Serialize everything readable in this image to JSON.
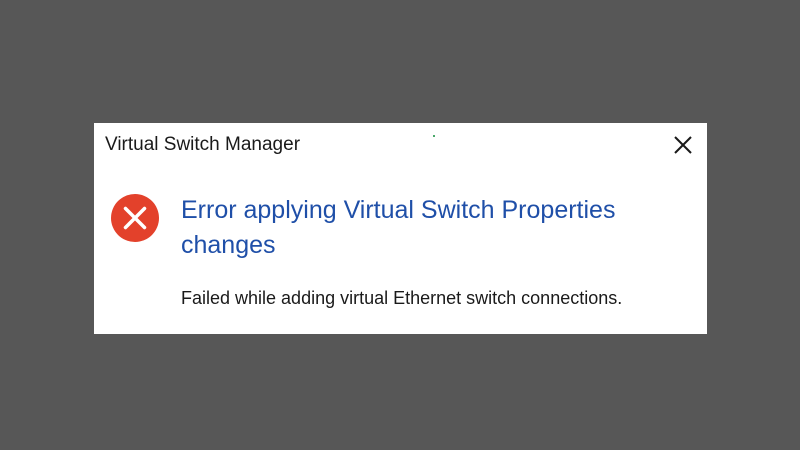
{
  "dialog": {
    "title": "Virtual Switch Manager",
    "close_icon": "close-icon",
    "status_icon": "error-icon",
    "heading": "Error applying Virtual Switch Properties changes",
    "message": "Failed while adding virtual Ethernet switch connections."
  },
  "colors": {
    "backdrop": "#575757",
    "heading": "#1f4fa8",
    "error_icon": "#e3412b"
  }
}
